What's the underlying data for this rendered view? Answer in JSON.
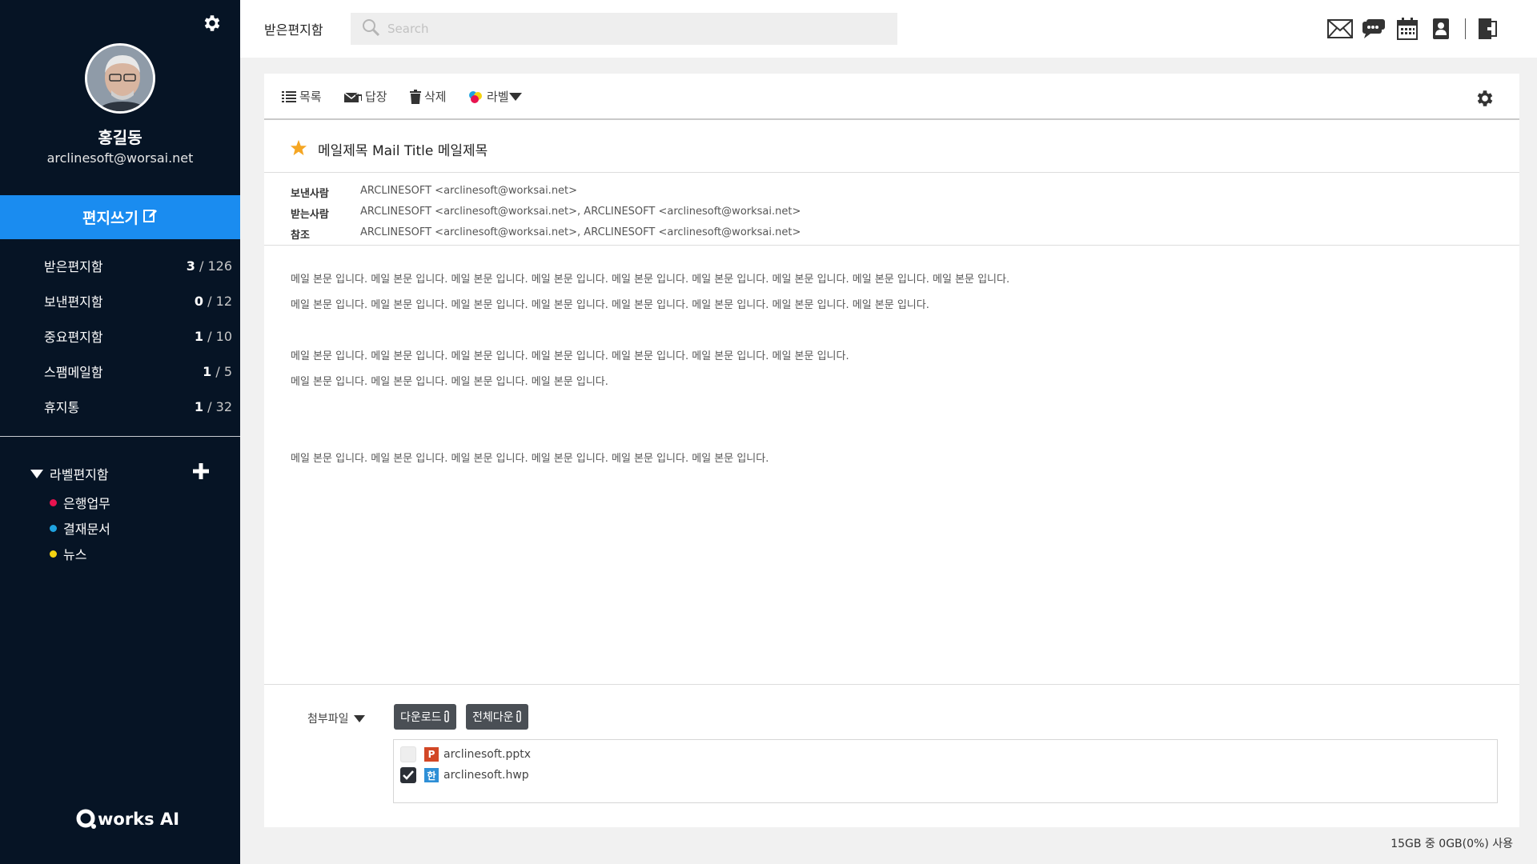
{
  "sidebar": {
    "user_name": "홍길동",
    "user_email": "arclinesoft@worsai.net",
    "compose_label": "편지쓰기",
    "folders": [
      {
        "name": "받은편지함",
        "unread": "3",
        "total": "/ 126"
      },
      {
        "name": "보낸편지함",
        "unread": "0",
        "total": "/ 12"
      },
      {
        "name": "중요편지함",
        "unread": "1",
        "total": "/ 10"
      },
      {
        "name": "스팸메일함",
        "unread": "1",
        "total": "/ 5"
      },
      {
        "name": "휴지통",
        "unread": "1",
        "total": "/ 32"
      }
    ],
    "labels_title": "라벨편지함",
    "labels": [
      {
        "name": "은행업무",
        "color": "#e8134f"
      },
      {
        "name": "결재문서",
        "color": "#1fa3e0"
      },
      {
        "name": "뉴스",
        "color": "#f5d311"
      }
    ],
    "logo_text": "works AI"
  },
  "topbar": {
    "title": "받은편지함",
    "search_placeholder": "Search",
    "icons": [
      "mail-icon",
      "chat-icon",
      "calendar-icon",
      "contacts-icon",
      "logout-icon"
    ]
  },
  "toolbar": {
    "list_label": "목록",
    "reply_label": "답장",
    "delete_label": "삭제",
    "label_label": "라벨"
  },
  "mail": {
    "subject": "메일제목 Mail Title 메일제목",
    "from_key": "보낸사람",
    "from_value": "ARCLINESOFT <arclinesoft@worksai.net>",
    "to_key": "받는사람",
    "to_value": "ARCLINESOFT <arclinesoft@worksai.net>, ARCLINESOFT <arclinesoft@worksai.net>",
    "cc_key": "참조",
    "cc_value": "ARCLINESOFT <arclinesoft@worksai.net>, ARCLINESOFT <arclinesoft@worksai.net>",
    "body": [
      "메일 본문 입니다. 메일 본문 입니다. 메일 본문 입니다. 메일 본문 입니다. 메일 본문 입니다. 메일 본문 입니다. 메일 본문 입니다. 메일 본문 입니다. 메일 본문 입니다.",
      "메일 본문 입니다. 메일 본문 입니다. 메일 본문 입니다. 메일 본문 입니다. 메일 본문 입니다. 메일 본문 입니다. 메일 본문 입니다. 메일 본문 입니다.",
      "메일 본문 입니다. 메일 본문 입니다. 메일 본문 입니다. 메일 본문 입니다. 메일 본문 입니다. 메일 본문 입니다. 메일 본문 입니다.",
      "메일 본문 입니다. 메일 본문 입니다. 메일 본문 입니다. 메일 본문 입니다.",
      "메일 본문 입니다. 메일 본문 입니다. 메일 본문 입니다. 메일 본문 입니다. 메일 본문 입니다. 메일 본문 입니다."
    ]
  },
  "attachments": {
    "label": "첨부파일",
    "download_label": "다운로드",
    "download_all_label": "전체다운",
    "files": [
      {
        "name": "arclinesoft.pptx",
        "checked": false,
        "icon_letter": "P",
        "icon_color": "#d24726"
      },
      {
        "name": "arclinesoft.hwp",
        "checked": true,
        "icon_letter": "한",
        "icon_color": "#2e8fd6"
      }
    ]
  },
  "footer": {
    "storage": "15GB 중 0GB(0%) 사용"
  },
  "colors": {
    "sidebar_bg": "#061425",
    "accent": "#1a8cf0",
    "star": "#f5a623"
  }
}
